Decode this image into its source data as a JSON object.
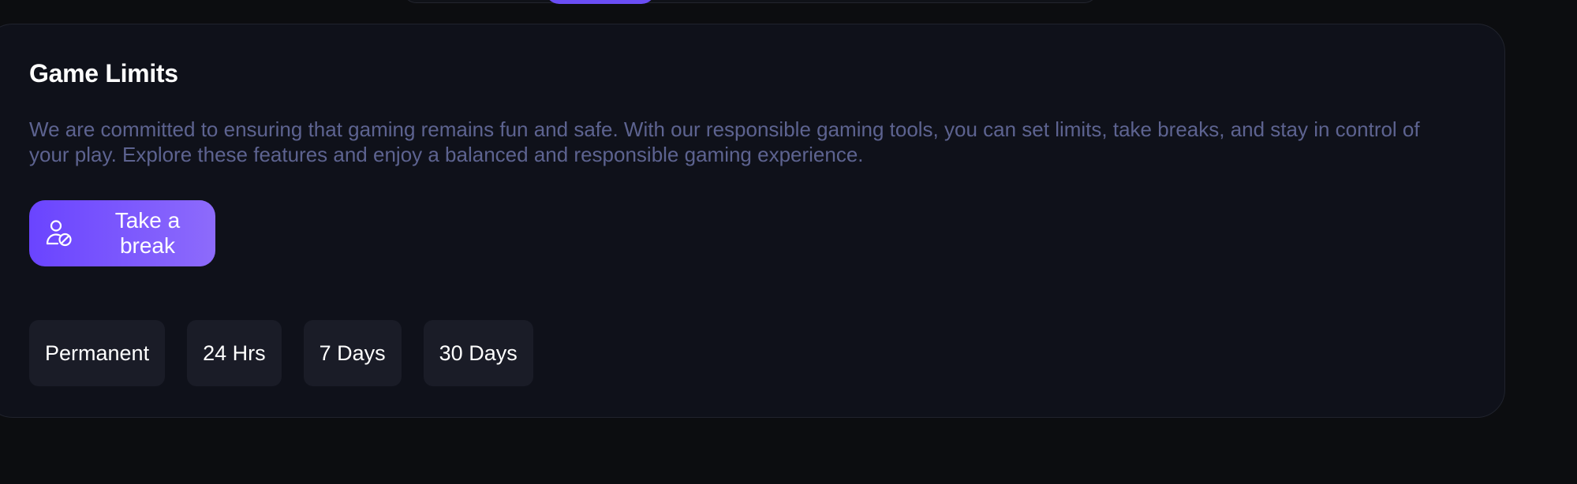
{
  "colors": {
    "page_bg": "#0c0d10",
    "card_bg": "#0f111a",
    "accent_start": "#6a44ff",
    "accent_end": "#8d6bfb",
    "description_text": "#5d6390",
    "option_bg": "#1a1c27"
  },
  "game_limits": {
    "title": "Game Limits",
    "description": "We are committed to ensuring that gaming remains fun and safe. With our responsible gaming tools, you can set limits, take breaks, and stay in control of your play. Explore these features and enjoy a balanced and responsible gaming experience.",
    "take_break_button": {
      "label": "Take a break",
      "icon": "user-check-icon"
    },
    "durations": [
      {
        "label": "Permanent"
      },
      {
        "label": "24 Hrs"
      },
      {
        "label": "7 Days"
      },
      {
        "label": "30 Days"
      }
    ]
  }
}
